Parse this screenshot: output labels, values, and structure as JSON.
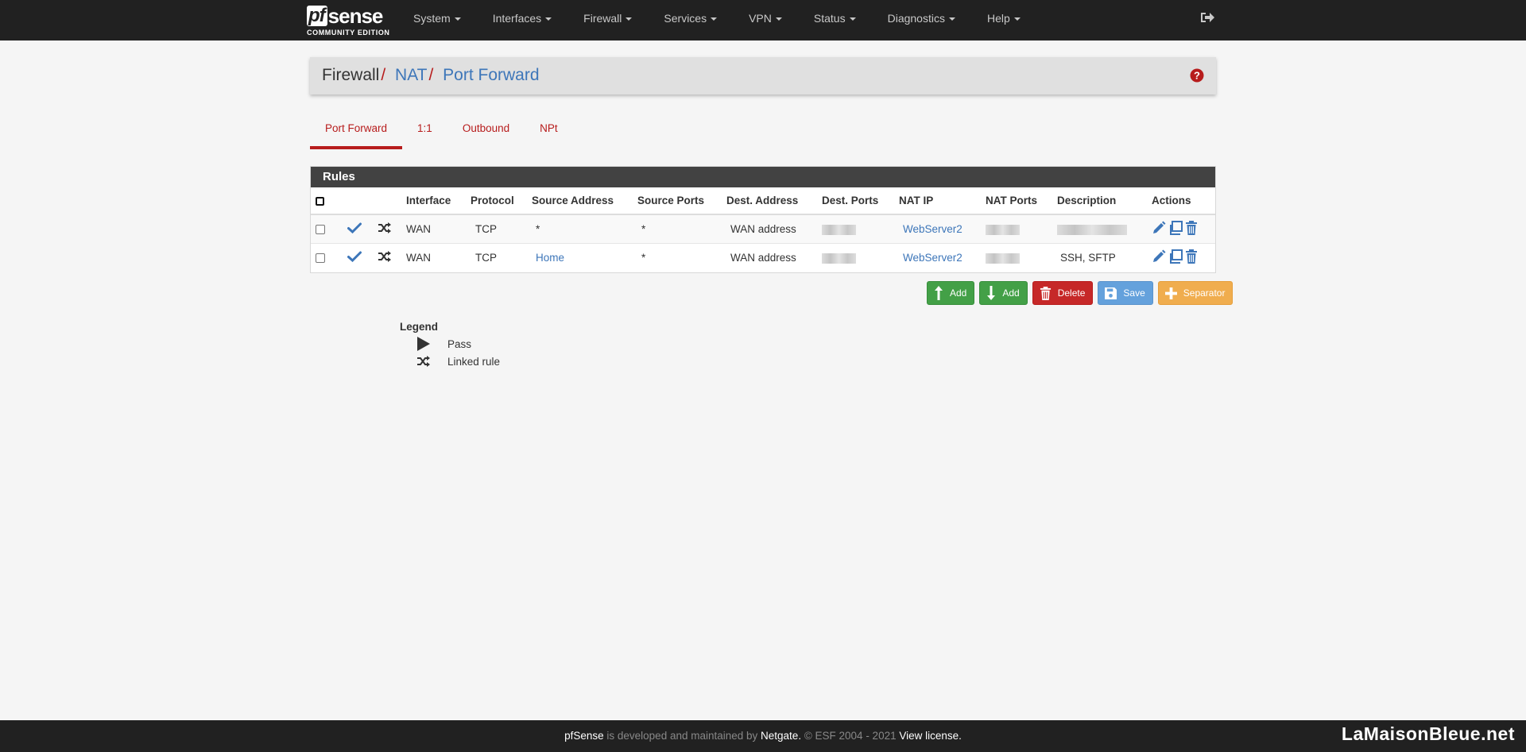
{
  "logo": {
    "main_a": "pf",
    "main_b": "sense",
    "subtitle": "COMMUNITY EDITION"
  },
  "nav": {
    "items": [
      "System",
      "Interfaces",
      "Firewall",
      "Services",
      "VPN",
      "Status",
      "Diagnostics",
      "Help"
    ],
    "logout_icon": "sign-out-icon"
  },
  "breadcrumb": {
    "first": "Firewall",
    "second": "NAT",
    "third": "Port Forward",
    "sep": "/"
  },
  "tabs": [
    "Port Forward",
    "1:1",
    "Outbound",
    "NPt"
  ],
  "rules": {
    "title": "Rules",
    "columns": [
      "Interface",
      "Protocol",
      "Source Address",
      "Source Ports",
      "Dest. Address",
      "Dest. Ports",
      "NAT IP",
      "NAT Ports",
      "Description",
      "Actions"
    ],
    "rows": [
      {
        "interface": "WAN",
        "protocol": "TCP",
        "source_address": "*",
        "source_ports": "*",
        "dest_address": "WAN address",
        "nat_ip": "WebServer2",
        "description": ""
      },
      {
        "interface": "WAN",
        "protocol": "TCP",
        "source_address": "Home",
        "source_ports": "*",
        "dest_address": "WAN address",
        "nat_ip": "WebServer2",
        "description": "SSH, SFTP"
      }
    ]
  },
  "buttons": {
    "add_top": "Add",
    "add_bottom": "Add",
    "delete": "Delete",
    "save": "Save",
    "separator": "Separator"
  },
  "legend": {
    "title": "Legend",
    "pass": "Pass",
    "linked": "Linked rule"
  },
  "footer": {
    "brand": "pfSense",
    "middle": " is developed and maintained by ",
    "company": "Netgate.",
    "copyright": " © ESF 2004 - 2021 ",
    "license": "View license."
  },
  "watermark": "LaMaisonBleue.net",
  "colors": {
    "brand_red": "#b71c1c",
    "link_blue": "#3d76b9",
    "navbar": "#212121"
  }
}
